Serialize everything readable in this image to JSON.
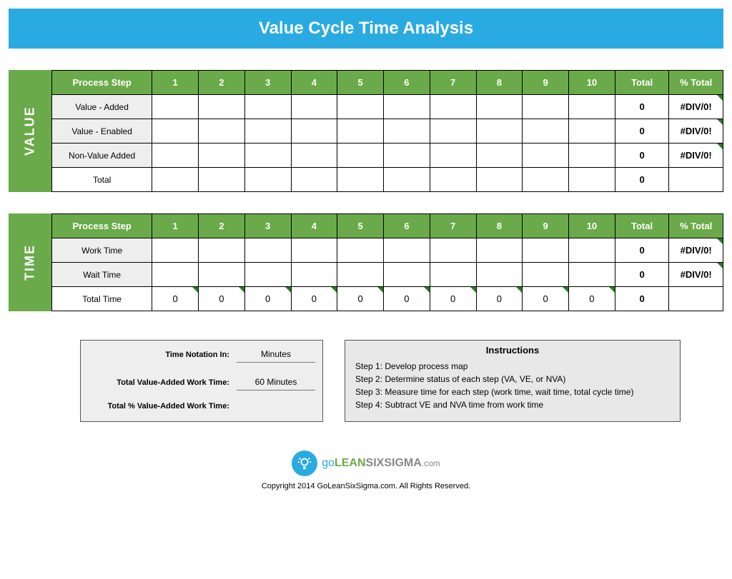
{
  "title": "Value Cycle Time Analysis",
  "sections": [
    {
      "label": "VALUE",
      "header": [
        "Process Step",
        "1",
        "2",
        "3",
        "4",
        "5",
        "6",
        "7",
        "8",
        "9",
        "10",
        "Total",
        "% Total"
      ],
      "rows": [
        {
          "label": "Value - Added",
          "cells": [
            "",
            "",
            "",
            "",
            "",
            "",
            "",
            "",
            "",
            ""
          ],
          "total": "0",
          "pct": "#DIV/0!",
          "tri": true
        },
        {
          "label": "Value - Enabled",
          "cells": [
            "",
            "",
            "",
            "",
            "",
            "",
            "",
            "",
            "",
            ""
          ],
          "total": "0",
          "pct": "#DIV/0!",
          "tri": true
        },
        {
          "label": "Non-Value Added",
          "cells": [
            "",
            "",
            "",
            "",
            "",
            "",
            "",
            "",
            "",
            ""
          ],
          "total": "0",
          "pct": "#DIV/0!",
          "tri": true
        },
        {
          "label": "Total",
          "cells": [
            "",
            "",
            "",
            "",
            "",
            "",
            "",
            "",
            "",
            ""
          ],
          "total": "0",
          "pct": "",
          "tri": false,
          "labelWhite": true
        }
      ]
    },
    {
      "label": "TIME",
      "header": [
        "Process Step",
        "1",
        "2",
        "3",
        "4",
        "5",
        "6",
        "7",
        "8",
        "9",
        "10",
        "Total",
        "% Total"
      ],
      "rows": [
        {
          "label": "Work Time",
          "cells": [
            "",
            "",
            "",
            "",
            "",
            "",
            "",
            "",
            "",
            ""
          ],
          "total": "0",
          "pct": "#DIV/0!",
          "tri": true
        },
        {
          "label": "Wait Time",
          "cells": [
            "",
            "",
            "",
            "",
            "",
            "",
            "",
            "",
            "",
            ""
          ],
          "total": "0",
          "pct": "#DIV/0!",
          "tri": true
        },
        {
          "label": "Total Time",
          "cells": [
            "0",
            "0",
            "0",
            "0",
            "0",
            "0",
            "0",
            "0",
            "0",
            "0"
          ],
          "total": "0",
          "pct": "",
          "tri": false,
          "labelWhite": true,
          "cellTri": true
        }
      ]
    }
  ],
  "summary": {
    "notation_label": "Time Notation In:",
    "notation_value": "Minutes",
    "total_va_label": "Total Value-Added Work Time:",
    "total_va_value": "60 Minutes",
    "pct_va_label": "Total % Value-Added Work Time:",
    "pct_va_value": ""
  },
  "instructions": {
    "title": "Instructions",
    "steps": [
      "Step 1:  Develop process map",
      "Step 2:  Determine status of each step (VA, VE, or NVA)",
      "Step 3:  Measure time for each step (work time, wait time, total cycle time)",
      "Step 4:  Subtract VE and NVA time from work time"
    ]
  },
  "logo": {
    "go": "go",
    "lean": "LEAN",
    "six": "SIXSIGMA",
    "com": ".com"
  },
  "copyright": "Copyright 2014 GoLeanSixSigma.com. All Rights Reserved."
}
